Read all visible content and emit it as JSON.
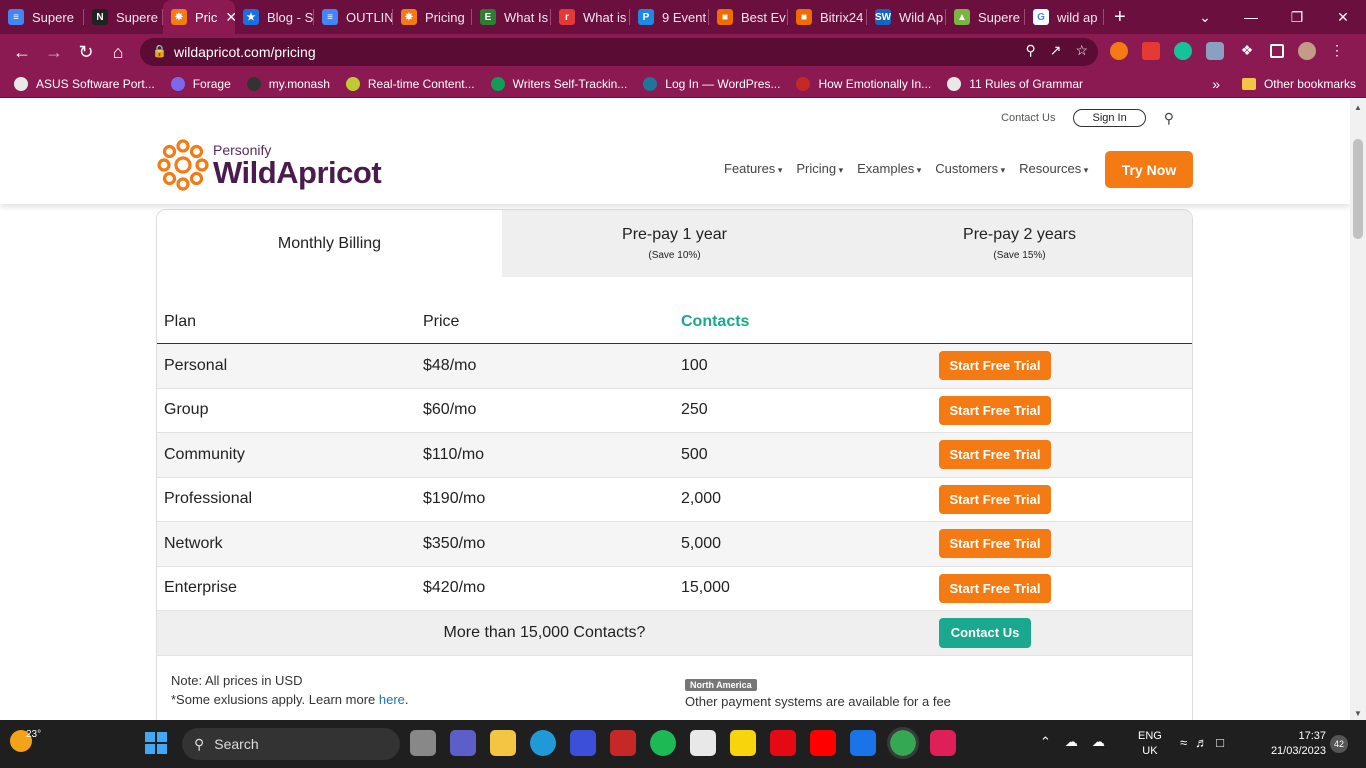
{
  "browser": {
    "tabs": [
      {
        "label": "Supere",
        "color": "#4285f4",
        "glyph": "≡"
      },
      {
        "label": "Supere",
        "color": "#222222",
        "glyph": "N"
      },
      {
        "label": "Pric",
        "color": "#f47a13",
        "glyph": "✵",
        "active": true
      },
      {
        "label": "Blog - S",
        "color": "#1d6fe0",
        "glyph": "★"
      },
      {
        "label": "OUTLIN",
        "color": "#4285f4",
        "glyph": "≡"
      },
      {
        "label": "Pricing",
        "color": "#f47a13",
        "glyph": "✵"
      },
      {
        "label": "What Is",
        "color": "#2e7d32",
        "glyph": "E"
      },
      {
        "label": "What is",
        "color": "#e53935",
        "glyph": "r"
      },
      {
        "label": "9 Event",
        "color": "#1e88e5",
        "glyph": "P"
      },
      {
        "label": "Best Ev",
        "color": "#ef6c00",
        "glyph": "■"
      },
      {
        "label": "Bitrix24",
        "color": "#ef6c00",
        "glyph": "■"
      },
      {
        "label": "Wild Ap",
        "color": "#1565c0",
        "glyph": "SW"
      },
      {
        "label": "Supere",
        "color": "#7cb342",
        "glyph": "▲"
      },
      {
        "label": "wild ap",
        "color": "#ffffff",
        "glyph": "G"
      }
    ],
    "url": "wildapricot.com/pricing",
    "bookmarks": [
      {
        "label": "ASUS Software Port...",
        "color": "#e8e8e8"
      },
      {
        "label": "Forage",
        "color": "#7b68ee"
      },
      {
        "label": "my.monash",
        "color": "#333333"
      },
      {
        "label": "Real-time Content...",
        "color": "#c0ca33"
      },
      {
        "label": "Writers Self-Trackin...",
        "color": "#0f9d58"
      },
      {
        "label": "Log In — WordPres...",
        "color": "#21759b"
      },
      {
        "label": "How Emotionally In...",
        "color": "#c62828"
      },
      {
        "label": "11 Rules of Grammar",
        "color": "#e8e8e8"
      }
    ],
    "other_bookmarks": "Other bookmarks"
  },
  "site": {
    "contact_us": "Contact Us",
    "sign_in": "Sign In",
    "logo_personify": "Personify",
    "logo_wild": "WildApricot",
    "nav": [
      "Features",
      "Pricing",
      "Examples",
      "Customers",
      "Resources"
    ],
    "try_now": "Try Now"
  },
  "pricing": {
    "billing_tabs": [
      {
        "title": "Monthly Billing",
        "subtitle": ""
      },
      {
        "title": "Pre-pay 1 year",
        "subtitle": "(Save 10%)"
      },
      {
        "title": "Pre-pay 2 years",
        "subtitle": "(Save 15%)"
      }
    ],
    "columns": [
      "Plan",
      "Price",
      "Contacts"
    ],
    "plans": [
      {
        "plan": "Personal",
        "price": "$48/mo",
        "contacts": "100",
        "cta": "Start Free Trial"
      },
      {
        "plan": "Group",
        "price": "$60/mo",
        "contacts": "250",
        "cta": "Start Free Trial"
      },
      {
        "plan": "Community",
        "price": "$110/mo",
        "contacts": "500",
        "cta": "Start Free Trial"
      },
      {
        "plan": "Professional",
        "price": "$190/mo",
        "contacts": "2,000",
        "cta": "Start Free Trial"
      },
      {
        "plan": "Network",
        "price": "$350/mo",
        "contacts": "5,000",
        "cta": "Start Free Trial"
      },
      {
        "plan": "Enterprise",
        "price": "$420/mo",
        "contacts": "15,000",
        "cta": "Start Free Trial"
      }
    ],
    "more_question": "More than 15,000 Contacts?",
    "more_cta": "Contact Us",
    "note_usd": "Note: All prices in USD",
    "note_exclusions": "*Some exlusions apply. Learn more",
    "note_link": "here",
    "region_badge": "North America",
    "region_text": "Other payment systems are available for a fee"
  },
  "taskbar": {
    "temperature": "23°",
    "search": "Search",
    "lang_1": "ENG",
    "lang_2": "UK",
    "time": "17:37",
    "date": "21/03/2023",
    "notifications": "42"
  },
  "colors": {
    "browser_frame": "#8c1a52",
    "brand_orange": "#f47a13",
    "brand_teal": "#1aa88e",
    "logo_purple": "#4a1c4d"
  }
}
